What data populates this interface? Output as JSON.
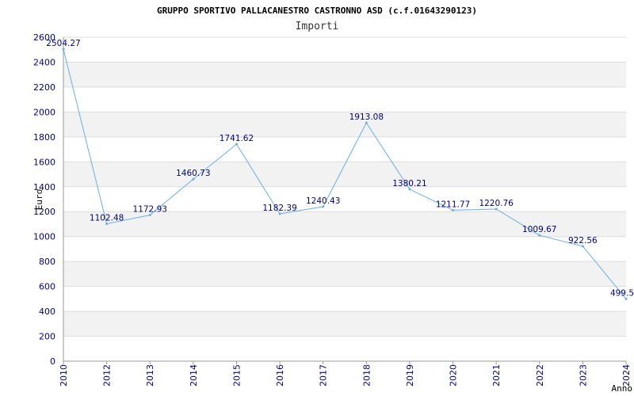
{
  "chart_data": {
    "type": "line",
    "title": "GRUPPO SPORTIVO PALLACANESTRO CASTRONNO ASD (c.f.01643290123)",
    "subtitle": "Importi",
    "xlabel": "Anno",
    "ylabel": "Euro",
    "categories": [
      "2010",
      "2012",
      "2013",
      "2014",
      "2015",
      "2016",
      "2017",
      "2018",
      "2019",
      "2020",
      "2021",
      "2022",
      "2023",
      "2024"
    ],
    "values": [
      2504.27,
      1102.48,
      1172.93,
      1460.73,
      1741.62,
      1182.39,
      1240.43,
      1913.08,
      1380.21,
      1211.77,
      1220.76,
      1009.67,
      922.56,
      499.5
    ],
    "data_labels": [
      "2504.27",
      "1102.48",
      "1172.93",
      "1460.73",
      "1741.62",
      "1182.39",
      "1240.43",
      "1913.08",
      "1380.21",
      "1211.77",
      "1220.76",
      "1009.67",
      "922.56",
      "499.5"
    ],
    "ylim": [
      0,
      2600
    ],
    "yticks": [
      "0",
      "200",
      "400",
      "600",
      "800",
      "1000",
      "1200",
      "1400",
      "1600",
      "1800",
      "2000",
      "2200",
      "2400",
      "2600"
    ],
    "grid": true,
    "colors": {
      "line": "#6aaee8",
      "band": "#f2f2f2",
      "grid": "#dddddd",
      "axis": "#9a9a9a",
      "tick_text": "#00008b"
    }
  }
}
